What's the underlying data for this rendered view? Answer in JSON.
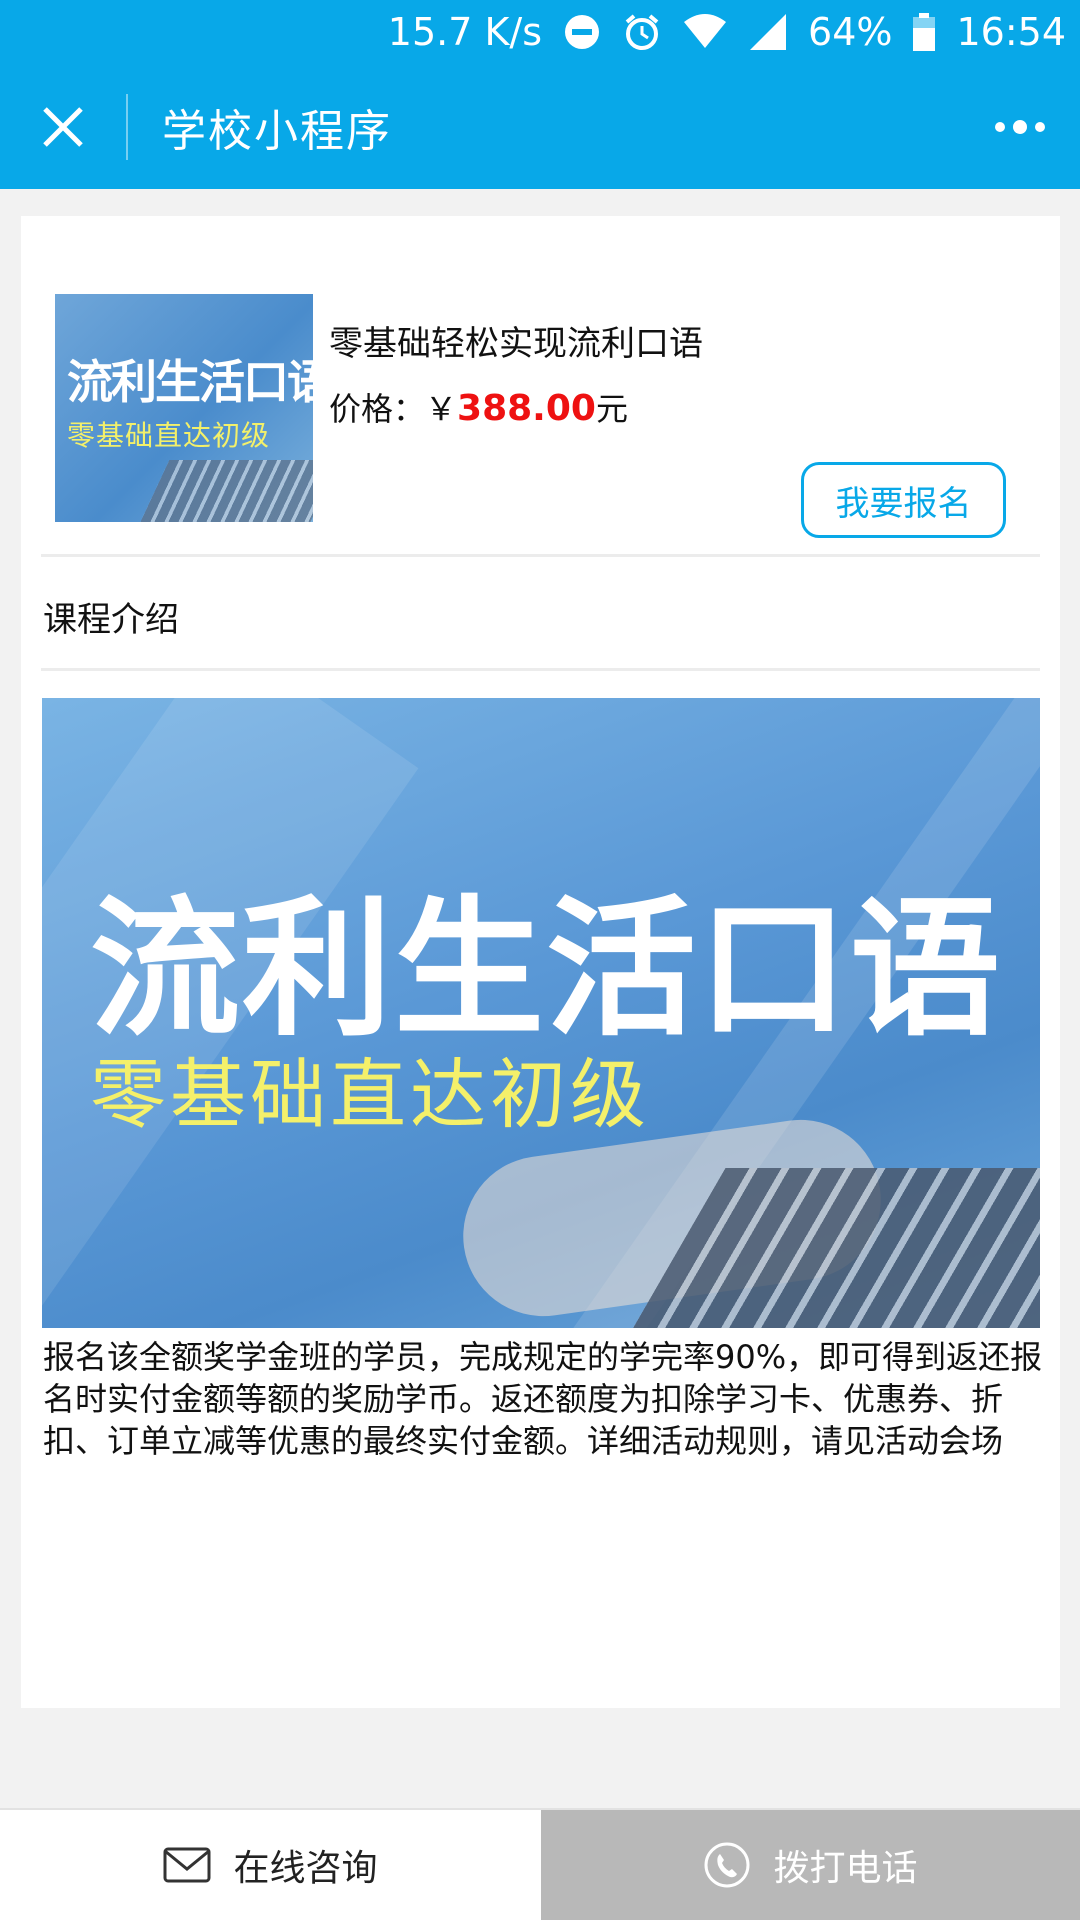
{
  "status_bar": {
    "speed": "15.7 K/s",
    "battery": "64%",
    "time": "16:54",
    "icons": [
      "dnd-icon",
      "alarm-icon",
      "wifi-icon",
      "signal-icon",
      "battery-icon"
    ]
  },
  "header": {
    "title": "学校小程序",
    "close_icon": "close-icon",
    "more_icon": "more-icon",
    "background": "#08a8e8"
  },
  "course": {
    "thumb_title": "流利生活口语",
    "thumb_subtitle": "零基础直达初级",
    "title": "零基础轻松实现流利口语",
    "price_label": "价格：￥",
    "price_value": "388.00",
    "price_unit": "元",
    "price_color": "#ee1111",
    "signup_label": "我要报名"
  },
  "intro": {
    "label": "课程介绍",
    "banner_title": "流利生活口语",
    "banner_subtitle": "零基础直达初级",
    "description": "报名该全额奖学金班的学员，完成规定的学完率90%，即可得到返还报名时实付金额等额的奖励学币。返还额度为扣除学习卡、优惠券、折扣、订单立减等优惠的最终实付金额。详细活动规则，请见活动会场"
  },
  "bottom": {
    "consult_label": "在线咨询",
    "consult_icon": "mail-icon",
    "call_label": "拨打电话",
    "call_icon": "phone-icon"
  }
}
